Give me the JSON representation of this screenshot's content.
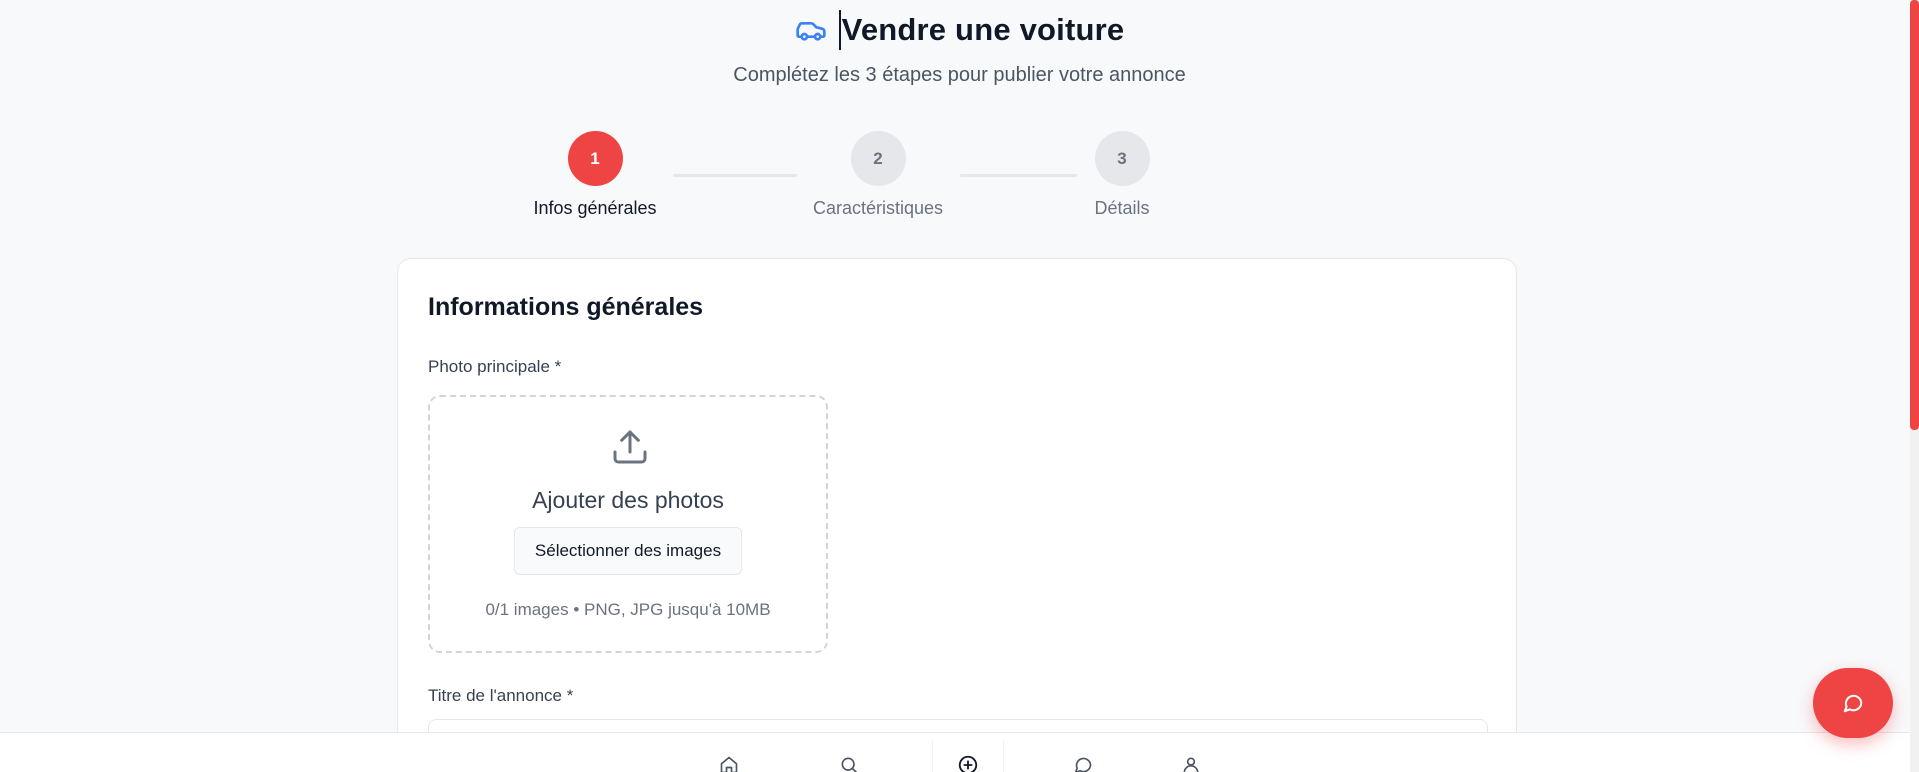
{
  "header": {
    "icon": "car-icon",
    "title": "Vendre une voiture",
    "subtitle": "Complétez les 3 étapes pour publier votre annonce"
  },
  "stepper": {
    "current_step": 1,
    "steps": [
      {
        "number": "1",
        "label": "Infos générales"
      },
      {
        "number": "2",
        "label": "Caractéristiques"
      },
      {
        "number": "3",
        "label": "Détails"
      }
    ]
  },
  "form": {
    "section_title": "Informations générales",
    "photo_label": "Photo principale *",
    "upload": {
      "icon": "upload-icon",
      "title": "Ajouter des photos",
      "button_label": "Sélectionner des images",
      "hint": "0/1 images • PNG, JPG jusqu'à 10MB"
    },
    "title_label": "Titre de l'annonce *",
    "title_value": ""
  },
  "bottom_nav": [
    {
      "icon": "home-icon"
    },
    {
      "icon": "search-icon"
    },
    {
      "icon": "add-circle-icon"
    },
    {
      "icon": "chat-icon"
    },
    {
      "icon": "user-icon"
    }
  ],
  "fab": {
    "icon": "chat-icon"
  },
  "colors": {
    "accent": "#ef4444",
    "car_icon": "#3b82f6",
    "background": "#f8f9fb",
    "muted_text": "#6b7280"
  }
}
